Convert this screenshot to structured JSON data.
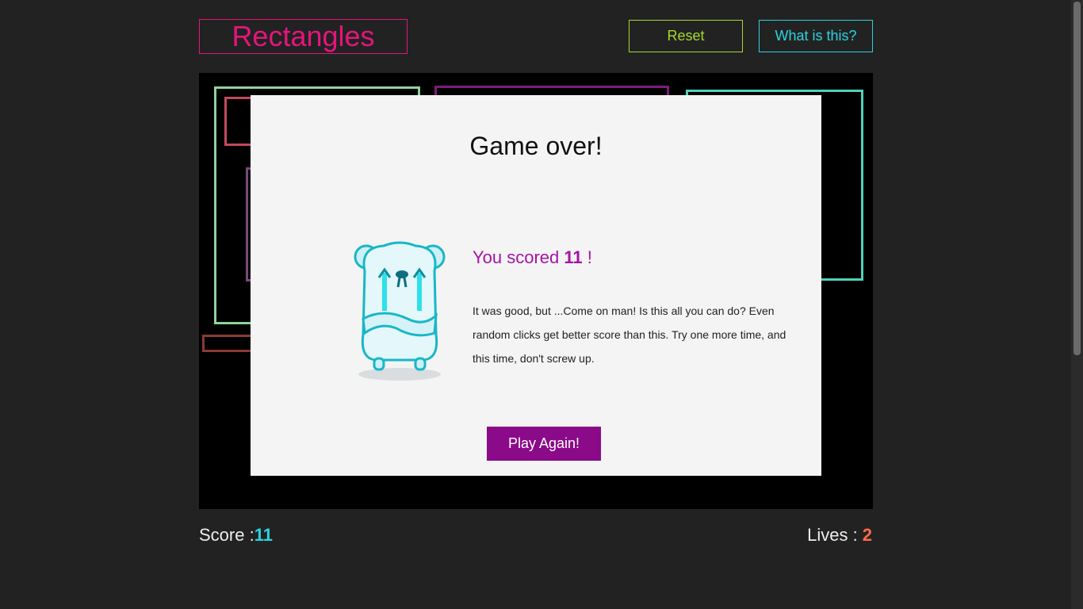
{
  "header": {
    "title": "Rectangles",
    "reset_label": "Reset",
    "what_label": "What is this?"
  },
  "colors": {
    "title": "#e5157b",
    "reset": "#a6d92a",
    "what": "#2ad4e0",
    "play_button": "#8a0a8a",
    "score_value": "#2ad4e0",
    "lives_value": "#ff6a4d"
  },
  "board": {
    "rectangle_colors": [
      "#8fd39b",
      "#c24a5c",
      "#7b1c7b",
      "#4fd1b8",
      "#7a4a7d",
      "#8a3a33"
    ]
  },
  "modal": {
    "title": "Game over!",
    "score_prefix": "You scored",
    "score_value": "11",
    "score_suffix": "!",
    "message": "It was good, but ...Come on man! Is this all you can do? Even random clicks get better score than this. Try one more time, and this time, don't screw up.",
    "play_again_label": "Play Again!",
    "mascot_icon": "crying-bear-icon"
  },
  "footer": {
    "score_label": "Score :",
    "score_value": "11",
    "lives_label": "Lives :",
    "lives_value": "2"
  }
}
